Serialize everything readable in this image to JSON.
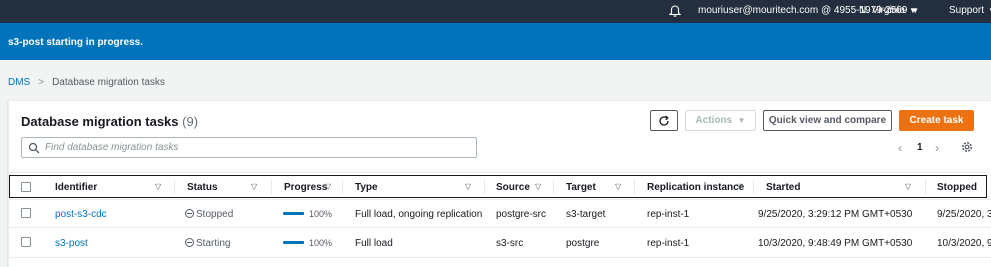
{
  "topbar": {
    "account": "mouriuser@mouritech.com @ 4955-1979-2569",
    "region": "N. Virginia",
    "support": "Support",
    "caret": "▼"
  },
  "flash": {
    "message": "s3-post starting in progress."
  },
  "breadcrumb": {
    "root": "DMS",
    "separator": ">",
    "current": "Database migration tasks"
  },
  "panel": {
    "title": "Database migration tasks",
    "count": "(9)",
    "buttons": {
      "actions": "Actions",
      "actions_caret": "▼",
      "compare": "Quick view and compare",
      "create": "Create task"
    },
    "search_placeholder": "Find database migration tasks",
    "pager": {
      "prev": "‹",
      "page": "1",
      "next": "›"
    }
  },
  "table": {
    "headers": {
      "identifier": "Identifier",
      "status": "Status",
      "progress": "Progress",
      "type": "Type",
      "source": "Source",
      "target": "Target",
      "replication_instance": "Replication instance",
      "started": "Started",
      "stopped": "Stopped",
      "filter_glyph": "▽"
    },
    "rows": [
      {
        "identifier": "post-s3-cdc",
        "status": "Stopped",
        "progress": "100%",
        "progress_value": 1.0,
        "type": "Full load, ongoing replication",
        "source": "postgre-src",
        "target": "s3-target",
        "replication_instance": "rep-inst-1",
        "started": "9/25/2020, 3:29:12 PM GMT+0530",
        "stopped": "9/25/2020, 3"
      },
      {
        "identifier": "s3-post",
        "status": "Starting",
        "progress": "100%",
        "progress_value": 1.0,
        "type": "Full load",
        "source": "s3-src",
        "target": "postgre",
        "replication_instance": "rep-inst-1",
        "started": "10/3/2020, 9:48:49 PM GMT+0530",
        "stopped": "10/3/2020, 9"
      }
    ]
  },
  "colors": {
    "topbar_bg": "#232f3e",
    "flash_bg": "#0073bb",
    "link": "#0073bb",
    "primary_button": "#ec7211",
    "page_bg": "#f2f3f3"
  }
}
